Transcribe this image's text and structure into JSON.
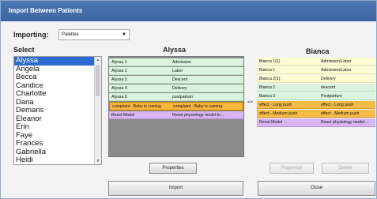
{
  "window": {
    "title": "Import Between Patients"
  },
  "importing": {
    "label": "Importing:",
    "value": "Palettes"
  },
  "select": {
    "label": "Select",
    "patients": [
      "Alyssa",
      "Angela",
      "Becca",
      "Candice",
      "Charlotte",
      "Dana",
      "Demaris",
      "Eleanor",
      "Erin",
      "Faye",
      "Frances",
      "Gabriella",
      "Heidi"
    ],
    "selected_index": 0
  },
  "alyssa": {
    "heading": "Alyssa",
    "rows": [
      {
        "name": "Alyssa 1",
        "value": "Admission",
        "color": "green"
      },
      {
        "name": "Alyssa 2",
        "value": "Labor",
        "color": "green"
      },
      {
        "name": "Alyssa 3",
        "value": "Descent",
        "color": "green"
      },
      {
        "name": "Alyssa 4",
        "value": "Delivery",
        "color": "green"
      },
      {
        "name": "Alyssa 5",
        "value": "postpartum",
        "color": "green"
      },
      {
        "name": "complaint - Baby is coming",
        "value": "complaint - Baby is coming",
        "color": "orange"
      },
      {
        "name": "Reset Model",
        "value": "Reset physiology model to ...",
        "color": "purple"
      }
    ]
  },
  "transfer_arrow": "=>",
  "bianca": {
    "heading": "Bianca",
    "rows": [
      {
        "name": "Bianca 1(1)",
        "value": "Admission/Labor",
        "color": "yellow"
      },
      {
        "name": "Bianca 1",
        "value": "Admission/Labor",
        "color": "yellow"
      },
      {
        "name": "Bianca 2(1)",
        "value": "Delivery",
        "color": "yellow"
      },
      {
        "name": "Bianca 2",
        "value": "descent",
        "color": "green"
      },
      {
        "name": "Bianca 3",
        "value": "Postpartum",
        "color": "green"
      },
      {
        "name": "effect - Long push",
        "value": "effect - Long push",
        "color": "orange2"
      },
      {
        "name": "effect - Medium push",
        "value": "effect - Medium push",
        "color": "orange2"
      },
      {
        "name": "Reset Model",
        "value": "Reset physiology model...",
        "color": "purple"
      }
    ]
  },
  "buttons": {
    "properties_left": "Properties",
    "properties_right": "Properties",
    "delete": "Delete",
    "import": "Import",
    "close": "Close"
  },
  "colors": {
    "titlebar": "#4a72b0",
    "selection": "#2a6ad1",
    "green_row": "#daf3dd",
    "yellow_row": "#fdfbd3",
    "orange_row": "#f7b63e",
    "purple_row": "#d8b6f4",
    "panel_bg": "#8a8a8a"
  }
}
